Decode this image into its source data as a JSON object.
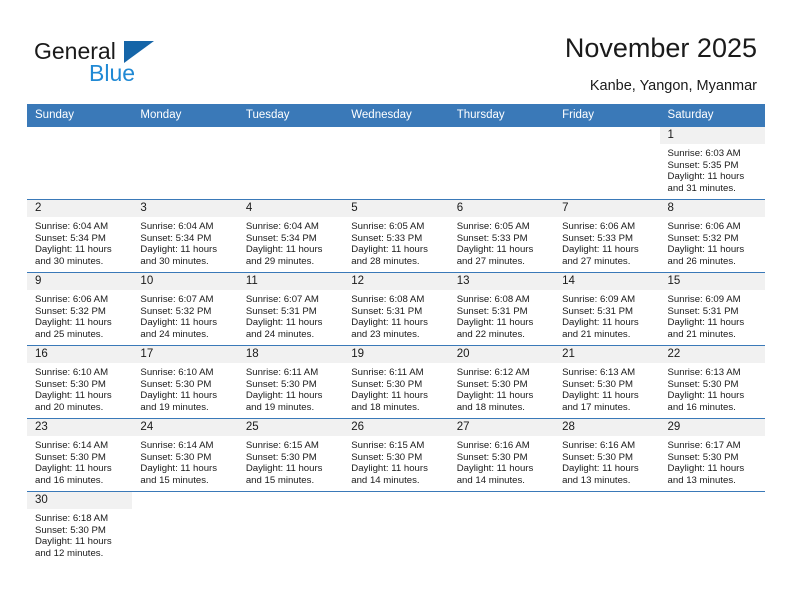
{
  "brand": {
    "name_part1": "General",
    "name_part2": "Blue",
    "triangle_icon": "triangle-icon",
    "accent_blue": "#2089d4",
    "dark_blue": "#1565a8"
  },
  "header": {
    "title": "November 2025",
    "location": "Kanbe, Yangon, Myanmar"
  },
  "calendar": {
    "header_color": "#3a79b8",
    "daynum_band_color": "#f1f1f1",
    "weekdays": [
      "Sunday",
      "Monday",
      "Tuesday",
      "Wednesday",
      "Thursday",
      "Friday",
      "Saturday"
    ],
    "weeks": [
      [
        {
          "day": "",
          "blank": true
        },
        {
          "day": "",
          "blank": true
        },
        {
          "day": "",
          "blank": true
        },
        {
          "day": "",
          "blank": true
        },
        {
          "day": "",
          "blank": true
        },
        {
          "day": "",
          "blank": true
        },
        {
          "day": "1",
          "sunrise": "Sunrise: 6:03 AM",
          "sunset": "Sunset: 5:35 PM",
          "daylight_line1": "Daylight: 11 hours",
          "daylight_line2": "and 31 minutes."
        }
      ],
      [
        {
          "day": "2",
          "sunrise": "Sunrise: 6:04 AM",
          "sunset": "Sunset: 5:34 PM",
          "daylight_line1": "Daylight: 11 hours",
          "daylight_line2": "and 30 minutes."
        },
        {
          "day": "3",
          "sunrise": "Sunrise: 6:04 AM",
          "sunset": "Sunset: 5:34 PM",
          "daylight_line1": "Daylight: 11 hours",
          "daylight_line2": "and 30 minutes."
        },
        {
          "day": "4",
          "sunrise": "Sunrise: 6:04 AM",
          "sunset": "Sunset: 5:34 PM",
          "daylight_line1": "Daylight: 11 hours",
          "daylight_line2": "and 29 minutes."
        },
        {
          "day": "5",
          "sunrise": "Sunrise: 6:05 AM",
          "sunset": "Sunset: 5:33 PM",
          "daylight_line1": "Daylight: 11 hours",
          "daylight_line2": "and 28 minutes."
        },
        {
          "day": "6",
          "sunrise": "Sunrise: 6:05 AM",
          "sunset": "Sunset: 5:33 PM",
          "daylight_line1": "Daylight: 11 hours",
          "daylight_line2": "and 27 minutes."
        },
        {
          "day": "7",
          "sunrise": "Sunrise: 6:06 AM",
          "sunset": "Sunset: 5:33 PM",
          "daylight_line1": "Daylight: 11 hours",
          "daylight_line2": "and 27 minutes."
        },
        {
          "day": "8",
          "sunrise": "Sunrise: 6:06 AM",
          "sunset": "Sunset: 5:32 PM",
          "daylight_line1": "Daylight: 11 hours",
          "daylight_line2": "and 26 minutes."
        }
      ],
      [
        {
          "day": "9",
          "sunrise": "Sunrise: 6:06 AM",
          "sunset": "Sunset: 5:32 PM",
          "daylight_line1": "Daylight: 11 hours",
          "daylight_line2": "and 25 minutes."
        },
        {
          "day": "10",
          "sunrise": "Sunrise: 6:07 AM",
          "sunset": "Sunset: 5:32 PM",
          "daylight_line1": "Daylight: 11 hours",
          "daylight_line2": "and 24 minutes."
        },
        {
          "day": "11",
          "sunrise": "Sunrise: 6:07 AM",
          "sunset": "Sunset: 5:31 PM",
          "daylight_line1": "Daylight: 11 hours",
          "daylight_line2": "and 24 minutes."
        },
        {
          "day": "12",
          "sunrise": "Sunrise: 6:08 AM",
          "sunset": "Sunset: 5:31 PM",
          "daylight_line1": "Daylight: 11 hours",
          "daylight_line2": "and 23 minutes."
        },
        {
          "day": "13",
          "sunrise": "Sunrise: 6:08 AM",
          "sunset": "Sunset: 5:31 PM",
          "daylight_line1": "Daylight: 11 hours",
          "daylight_line2": "and 22 minutes."
        },
        {
          "day": "14",
          "sunrise": "Sunrise: 6:09 AM",
          "sunset": "Sunset: 5:31 PM",
          "daylight_line1": "Daylight: 11 hours",
          "daylight_line2": "and 21 minutes."
        },
        {
          "day": "15",
          "sunrise": "Sunrise: 6:09 AM",
          "sunset": "Sunset: 5:31 PM",
          "daylight_line1": "Daylight: 11 hours",
          "daylight_line2": "and 21 minutes."
        }
      ],
      [
        {
          "day": "16",
          "sunrise": "Sunrise: 6:10 AM",
          "sunset": "Sunset: 5:30 PM",
          "daylight_line1": "Daylight: 11 hours",
          "daylight_line2": "and 20 minutes."
        },
        {
          "day": "17",
          "sunrise": "Sunrise: 6:10 AM",
          "sunset": "Sunset: 5:30 PM",
          "daylight_line1": "Daylight: 11 hours",
          "daylight_line2": "and 19 minutes."
        },
        {
          "day": "18",
          "sunrise": "Sunrise: 6:11 AM",
          "sunset": "Sunset: 5:30 PM",
          "daylight_line1": "Daylight: 11 hours",
          "daylight_line2": "and 19 minutes."
        },
        {
          "day": "19",
          "sunrise": "Sunrise: 6:11 AM",
          "sunset": "Sunset: 5:30 PM",
          "daylight_line1": "Daylight: 11 hours",
          "daylight_line2": "and 18 minutes."
        },
        {
          "day": "20",
          "sunrise": "Sunrise: 6:12 AM",
          "sunset": "Sunset: 5:30 PM",
          "daylight_line1": "Daylight: 11 hours",
          "daylight_line2": "and 18 minutes."
        },
        {
          "day": "21",
          "sunrise": "Sunrise: 6:13 AM",
          "sunset": "Sunset: 5:30 PM",
          "daylight_line1": "Daylight: 11 hours",
          "daylight_line2": "and 17 minutes."
        },
        {
          "day": "22",
          "sunrise": "Sunrise: 6:13 AM",
          "sunset": "Sunset: 5:30 PM",
          "daylight_line1": "Daylight: 11 hours",
          "daylight_line2": "and 16 minutes."
        }
      ],
      [
        {
          "day": "23",
          "sunrise": "Sunrise: 6:14 AM",
          "sunset": "Sunset: 5:30 PM",
          "daylight_line1": "Daylight: 11 hours",
          "daylight_line2": "and 16 minutes."
        },
        {
          "day": "24",
          "sunrise": "Sunrise: 6:14 AM",
          "sunset": "Sunset: 5:30 PM",
          "daylight_line1": "Daylight: 11 hours",
          "daylight_line2": "and 15 minutes."
        },
        {
          "day": "25",
          "sunrise": "Sunrise: 6:15 AM",
          "sunset": "Sunset: 5:30 PM",
          "daylight_line1": "Daylight: 11 hours",
          "daylight_line2": "and 15 minutes."
        },
        {
          "day": "26",
          "sunrise": "Sunrise: 6:15 AM",
          "sunset": "Sunset: 5:30 PM",
          "daylight_line1": "Daylight: 11 hours",
          "daylight_line2": "and 14 minutes."
        },
        {
          "day": "27",
          "sunrise": "Sunrise: 6:16 AM",
          "sunset": "Sunset: 5:30 PM",
          "daylight_line1": "Daylight: 11 hours",
          "daylight_line2": "and 14 minutes."
        },
        {
          "day": "28",
          "sunrise": "Sunrise: 6:16 AM",
          "sunset": "Sunset: 5:30 PM",
          "daylight_line1": "Daylight: 11 hours",
          "daylight_line2": "and 13 minutes."
        },
        {
          "day": "29",
          "sunrise": "Sunrise: 6:17 AM",
          "sunset": "Sunset: 5:30 PM",
          "daylight_line1": "Daylight: 11 hours",
          "daylight_line2": "and 13 minutes."
        }
      ],
      [
        {
          "day": "30",
          "sunrise": "Sunrise: 6:18 AM",
          "sunset": "Sunset: 5:30 PM",
          "daylight_line1": "Daylight: 11 hours",
          "daylight_line2": "and 12 minutes."
        },
        {
          "day": "",
          "blank": true
        },
        {
          "day": "",
          "blank": true
        },
        {
          "day": "",
          "blank": true
        },
        {
          "day": "",
          "blank": true
        },
        {
          "day": "",
          "blank": true
        },
        {
          "day": "",
          "blank": true
        }
      ]
    ]
  }
}
